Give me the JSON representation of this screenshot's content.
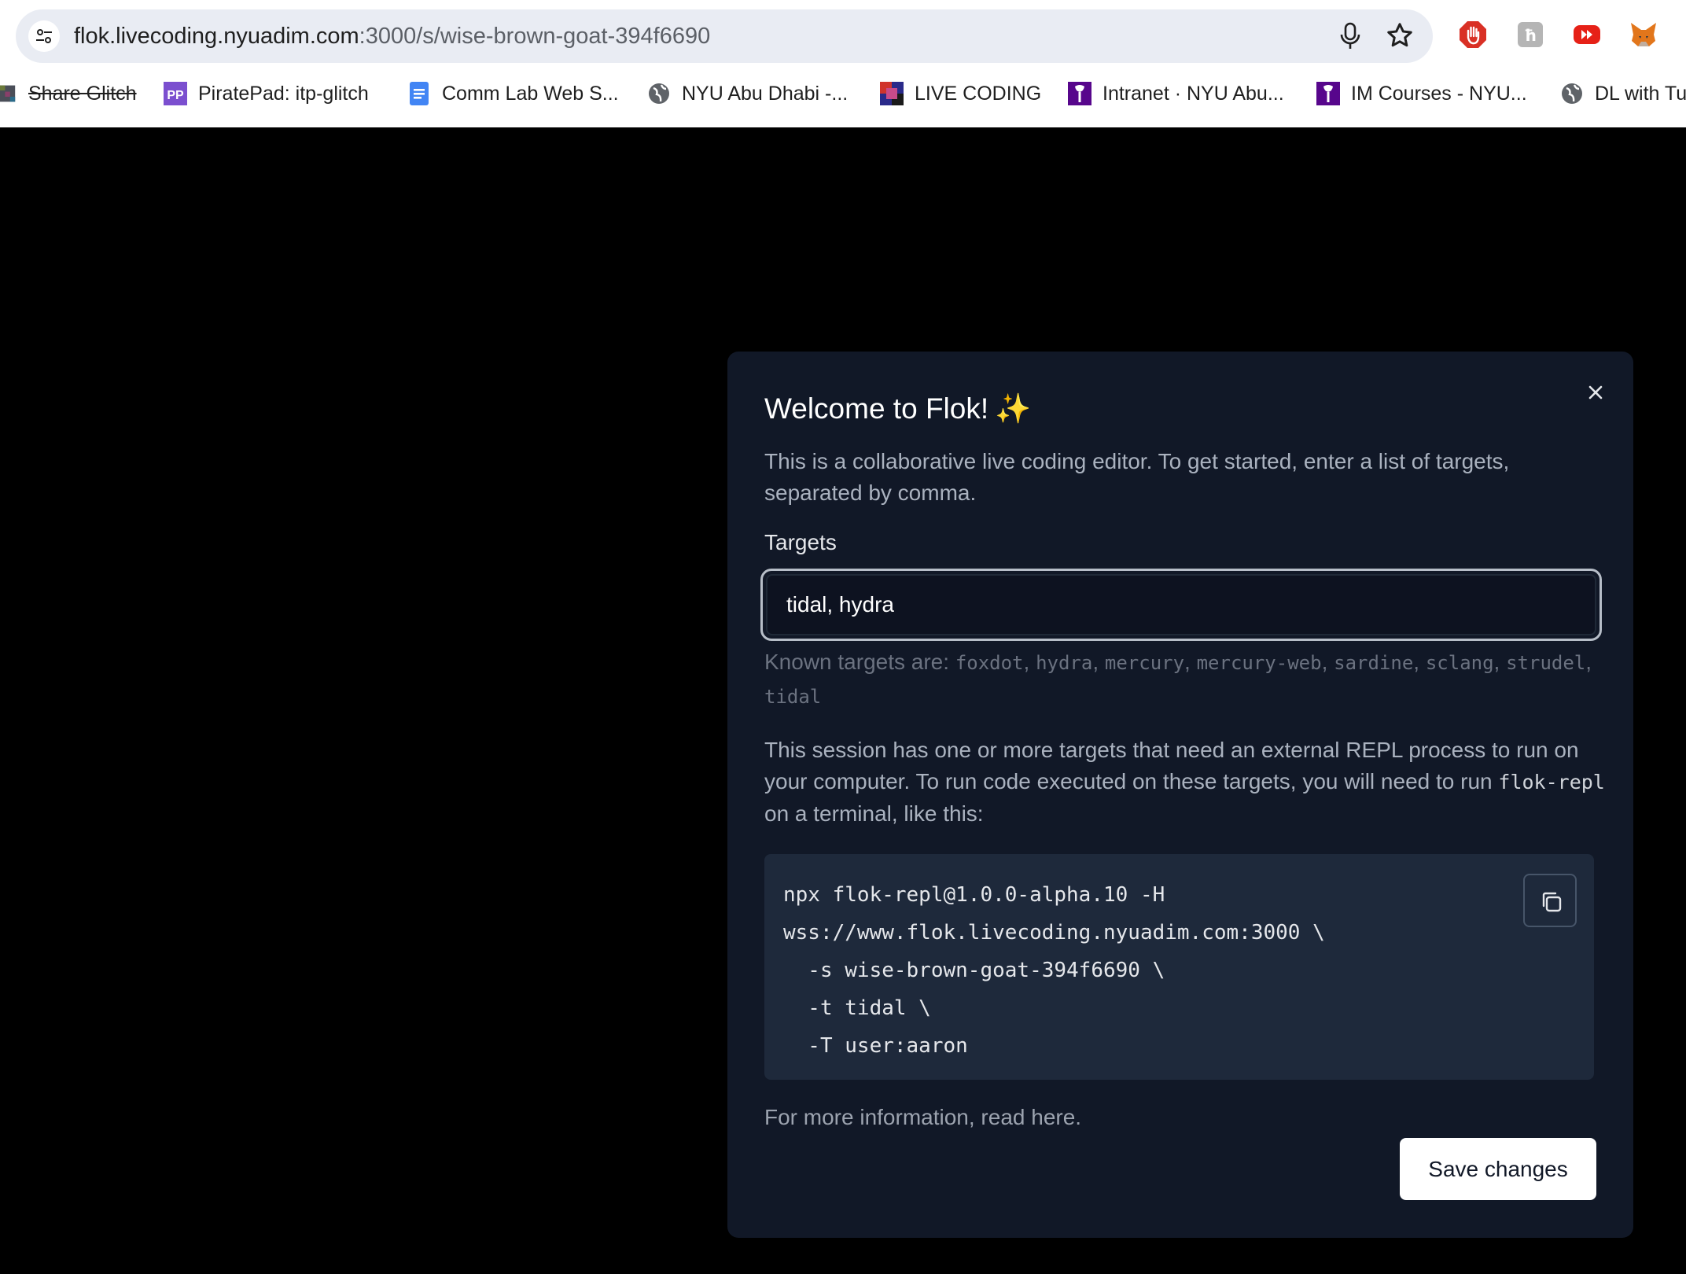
{
  "browser": {
    "url_host": "flok.livecoding.nyuadim.com",
    "url_path": ":3000/s/wise-brown-goat-394f6690",
    "extension_icons": [
      "adblock-icon",
      "h-extension-icon",
      "youtube-extension-icon",
      "metamask-fox-icon"
    ]
  },
  "bookmarks": [
    {
      "label": "Share Glitch",
      "icon": "glitch-icon"
    },
    {
      "label": "PiratePad: itp-glitch",
      "icon": "piratepad-icon"
    },
    {
      "label": "Comm Lab Web S...",
      "icon": "google-docs-icon"
    },
    {
      "label": "NYU Abu Dhabi -...",
      "icon": "globe-icon"
    },
    {
      "label": "LIVE CODING",
      "icon": "live-coding-icon"
    },
    {
      "label": "Intranet · NYU Abu...",
      "icon": "nyu-torch-icon"
    },
    {
      "label": "IM Courses - NYU...",
      "icon": "nyu-torch-icon"
    },
    {
      "label": "DL with Tu",
      "icon": "globe-icon"
    }
  ],
  "modal": {
    "title": "Welcome to Flok!",
    "title_emoji": "✨",
    "description": "This is a collaborative live coding editor. To get started, enter a list of targets, separated by comma.",
    "targets_label": "Targets",
    "targets_value": "tidal, hydra",
    "known_prefix": "Known targets are:",
    "known_targets": [
      "foxdot",
      "hydra",
      "mercury",
      "mercury-web",
      "sardine",
      "sclang",
      "strudel",
      "tidal"
    ],
    "session_text_1": "This session has one or more targets that need an external REPL process to run on your computer. To run code executed on these targets, you will need to run",
    "session_code": "flok-repl",
    "session_text_2": "on a terminal, like this:",
    "code_lines": [
      "npx flok-repl@1.0.0-alpha.10 -H",
      "wss://www.flok.livecoding.nyuadim.com:3000 \\",
      "  -s wise-brown-goat-394f6690 \\",
      "  -t tidal \\",
      "  -T user:aaron"
    ],
    "more_info": "For more information, read here.",
    "save_label": "Save changes",
    "colors": {
      "modal_bg": "#111827",
      "code_bg": "#1e293b",
      "input_border": "#b7bec8",
      "muted_text": "#aab2bf"
    }
  }
}
